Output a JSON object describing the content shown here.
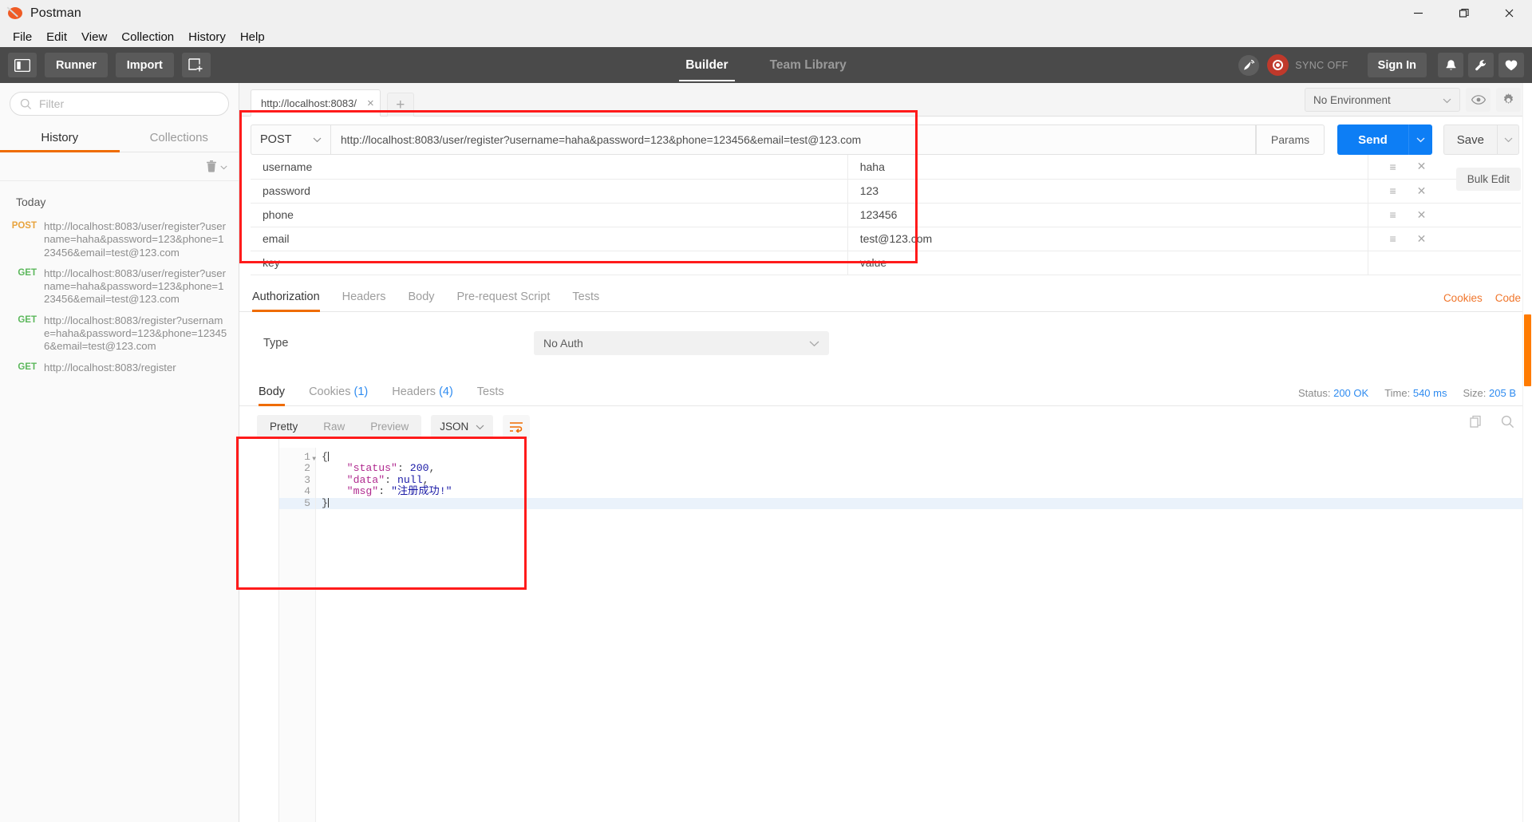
{
  "window": {
    "title": "Postman",
    "minimize": "minimize-icon",
    "maximize": "restore-icon",
    "close": "close-icon"
  },
  "menubar": {
    "items": [
      "File",
      "Edit",
      "View",
      "Collection",
      "History",
      "Help"
    ]
  },
  "toolbar": {
    "sidebar_toggle": "sidebar-toggle-icon",
    "runner_label": "Runner",
    "import_label": "Import",
    "new_tab_label": "new-window-icon",
    "tabs": [
      {
        "label": "Builder",
        "active": true
      },
      {
        "label": "Team Library",
        "active": false
      }
    ],
    "sync_label": "SYNC OFF",
    "signin_label": "Sign In",
    "notification_icon": "bell-icon",
    "settings_icon": "wrench-icon",
    "favorite_icon": "heart-icon",
    "broadcast_icon": "satellite-icon"
  },
  "sidebar": {
    "filter_placeholder": "Filter",
    "tabs": [
      {
        "label": "History",
        "active": true
      },
      {
        "label": "Collections",
        "active": false
      }
    ],
    "trash_icon": "trash-icon",
    "day_label": "Today",
    "history": [
      {
        "method": "POST",
        "url": "http://localhost:8083/user/register?username=haha&password=123&phone=123456&email=test@123.com"
      },
      {
        "method": "GET",
        "url": "http://localhost:8083/user/register?username=haha&password=123&phone=123456&email=test@123.com"
      },
      {
        "method": "GET",
        "url": "http://localhost:8083/register?username=haha&password=123&phone=123456&email=test@123.com"
      },
      {
        "method": "GET",
        "url": "http://localhost:8083/register"
      }
    ]
  },
  "request_tabs": {
    "open": [
      {
        "title": "http://localhost:8083/",
        "close": "×"
      }
    ],
    "new_tab": "+"
  },
  "environment": {
    "selected": "No Environment",
    "eye_icon": "eye-icon",
    "gear_icon": "gear-icon"
  },
  "request": {
    "method": "POST",
    "url": "http://localhost:8083/user/register?username=haha&password=123&phone=123456&email=test@123.com",
    "params_label": "Params",
    "send_label": "Send",
    "save_label": "Save",
    "bulk_edit_label": "Bulk Edit",
    "key_placeholder": "key",
    "value_placeholder": "value",
    "params": [
      {
        "key": "username",
        "value": "haha"
      },
      {
        "key": "password",
        "value": "123"
      },
      {
        "key": "phone",
        "value": "123456"
      },
      {
        "key": "email",
        "value": "test@123.com"
      }
    ],
    "tabs": [
      {
        "label": "Authorization",
        "active": true
      },
      {
        "label": "Headers",
        "active": false
      },
      {
        "label": "Body",
        "active": false
      },
      {
        "label": "Pre-request Script",
        "active": false
      },
      {
        "label": "Tests",
        "active": false
      }
    ],
    "cookies_link": "Cookies",
    "code_link": "Code",
    "auth": {
      "type_label": "Type",
      "type_value": "No Auth"
    }
  },
  "response": {
    "tabs": [
      {
        "label": "Body",
        "count": "",
        "active": true
      },
      {
        "label": "Cookies",
        "count": "(1)",
        "active": false
      },
      {
        "label": "Headers",
        "count": "(4)",
        "active": false
      },
      {
        "label": "Tests",
        "count": "",
        "active": false
      }
    ],
    "view_modes": [
      {
        "label": "Pretty",
        "active": true
      },
      {
        "label": "Raw",
        "active": false
      },
      {
        "label": "Preview",
        "active": false
      }
    ],
    "format": "JSON",
    "wrap_icon": "word-wrap-icon",
    "copy_icon": "copy-icon",
    "search_icon": "search-icon",
    "status_label": "Status:",
    "status_value": "200 OK",
    "time_label": "Time:",
    "time_value": "540 ms",
    "size_label": "Size:",
    "size_value": "205 B",
    "body_lines": [
      {
        "n": "1",
        "fold": true,
        "tokens": [
          {
            "t": "{",
            "c": "tk-brace"
          }
        ]
      },
      {
        "n": "2",
        "fold": false,
        "tokens": [
          {
            "t": "    \"status\"",
            "c": "tk-key"
          },
          {
            "t": ": ",
            "c": "tk-punc"
          },
          {
            "t": "200",
            "c": "tk-num"
          },
          {
            "t": ",",
            "c": "tk-punc"
          }
        ]
      },
      {
        "n": "3",
        "fold": false,
        "tokens": [
          {
            "t": "    \"data\"",
            "c": "tk-key"
          },
          {
            "t": ": ",
            "c": "tk-punc"
          },
          {
            "t": "null",
            "c": "tk-null"
          },
          {
            "t": ",",
            "c": "tk-punc"
          }
        ]
      },
      {
        "n": "4",
        "fold": false,
        "tokens": [
          {
            "t": "    \"msg\"",
            "c": "tk-key"
          },
          {
            "t": ": ",
            "c": "tk-punc"
          },
          {
            "t": "\"注册成功!\"",
            "c": "tk-str"
          }
        ]
      },
      {
        "n": "5",
        "fold": false,
        "highlight": true,
        "tokens": [
          {
            "t": "}",
            "c": "tk-brace"
          }
        ]
      }
    ]
  },
  "colors": {
    "accent_orange": "#ef6c00",
    "send_blue": "#0d7ef5",
    "highlight_red": "#ff1b1b",
    "method_post": "#e8a33d",
    "method_get": "#5cb85c",
    "toolbar_dark": "#4a4a4a"
  }
}
